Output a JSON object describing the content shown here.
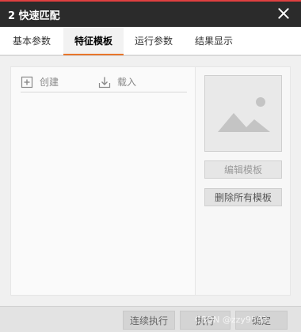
{
  "window": {
    "title": "2 快速匹配",
    "close_icon": "close-icon"
  },
  "tabs": [
    {
      "label": "基本参数",
      "active": false
    },
    {
      "label": "特征模板",
      "active": true
    },
    {
      "label": "运行参数",
      "active": false
    },
    {
      "label": "结果显示",
      "active": false
    }
  ],
  "template_list": {
    "create_label": "创建",
    "create_icon": "plus-square-icon",
    "load_label": "载入",
    "load_icon": "download-icon"
  },
  "preview": {
    "icon": "image-placeholder-icon"
  },
  "side_buttons": {
    "edit_label": "编辑模板",
    "delete_all_label": "删除所有模板"
  },
  "footer": {
    "continuous_label": "连续执行",
    "execute_label": "执行",
    "confirm_label": "确定",
    "watermark": "CSDN @zzy9563"
  },
  "colors": {
    "titlebar": "#2b2b2b",
    "accent": "#e8762b",
    "titlebar_top_border": "#e04040"
  }
}
